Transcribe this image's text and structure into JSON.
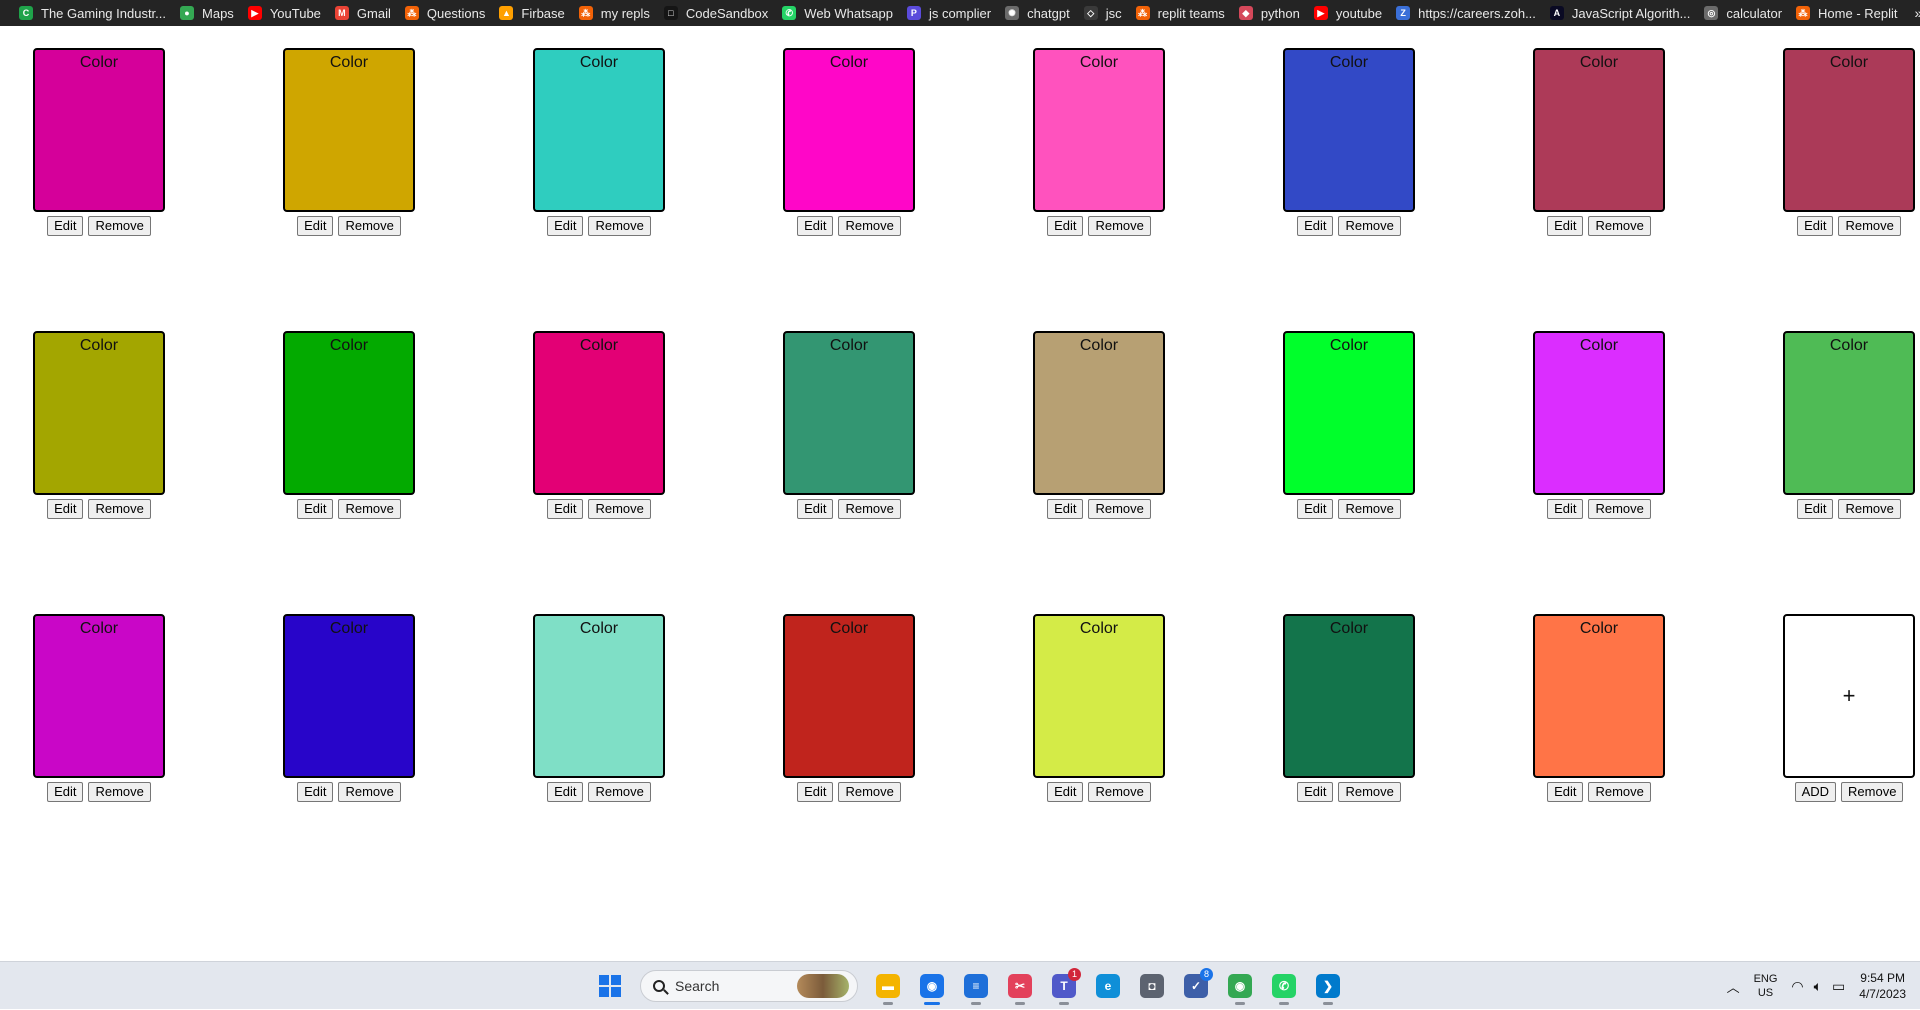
{
  "bookmarks": [
    {
      "label": "The Gaming Industr...",
      "icon": "codesandbox-green-icon",
      "color": "#1fa34a",
      "glyph": "C"
    },
    {
      "label": "Maps",
      "icon": "maps-pin-icon",
      "color": "#34a853",
      "glyph": "●"
    },
    {
      "label": "YouTube",
      "icon": "youtube-icon",
      "color": "#ff0000",
      "glyph": "▶"
    },
    {
      "label": "Gmail",
      "icon": "gmail-icon",
      "color": "#ea4335",
      "glyph": "M"
    },
    {
      "label": "Questions",
      "icon": "replit-icon",
      "color": "#f26207",
      "glyph": "⁂"
    },
    {
      "label": "Firbase",
      "icon": "firebase-icon",
      "color": "#ffa000",
      "glyph": "▲"
    },
    {
      "label": "my repls",
      "icon": "replit-icon",
      "color": "#f26207",
      "glyph": "⁂"
    },
    {
      "label": "CodeSandbox",
      "icon": "codesandbox-icon",
      "color": "#151515",
      "glyph": "□"
    },
    {
      "label": "Web Whatsapp",
      "icon": "whatsapp-icon",
      "color": "#25d366",
      "glyph": "✆"
    },
    {
      "label": "js complier",
      "icon": "js-compiler-icon",
      "color": "#5b4bdb",
      "glyph": "P"
    },
    {
      "label": "chatgpt",
      "icon": "chatgpt-icon",
      "color": "#6b6b6b",
      "glyph": "✺"
    },
    {
      "label": "jsc",
      "icon": "code-brackets-icon",
      "color": "#3a3a3a",
      "glyph": "◇"
    },
    {
      "label": "replit teams",
      "icon": "replit-icon",
      "color": "#f26207",
      "glyph": "⁂"
    },
    {
      "label": "python",
      "icon": "python-icon",
      "color": "#d5485a",
      "glyph": "◆"
    },
    {
      "label": "youtube",
      "icon": "youtube-icon",
      "color": "#ff0000",
      "glyph": "▶"
    },
    {
      "label": "https://careers.zoh...",
      "icon": "zoho-icon",
      "color": "#3a6fd8",
      "glyph": "Z"
    },
    {
      "label": "JavaScript Algorith...",
      "icon": "freecodecamp-icon",
      "color": "#0a0a23",
      "glyph": "A"
    },
    {
      "label": "calculator",
      "icon": "globe-icon",
      "color": "#6b6b6b",
      "glyph": "◎"
    },
    {
      "label": "Home - Replit",
      "icon": "replit-icon",
      "color": "#f26207",
      "glyph": "⁂"
    }
  ],
  "bookmarks_more": "»",
  "cards": [
    {
      "label": "Color",
      "color": "#d5009a"
    },
    {
      "label": "Color",
      "color": "#cfa600"
    },
    {
      "label": "Color",
      "color": "#2fcdbf"
    },
    {
      "label": "Color",
      "color": "#ff06c8"
    },
    {
      "label": "Color",
      "color": "#ff52be"
    },
    {
      "label": "Color",
      "color": "#3249c6"
    },
    {
      "label": "Color",
      "color": "#ad3a58"
    },
    {
      "label": "Color",
      "color": "#ab3a58"
    },
    {
      "label": "Color",
      "color": "#a3a600"
    },
    {
      "label": "Color",
      "color": "#03aa00"
    },
    {
      "label": "Color",
      "color": "#e30075"
    },
    {
      "label": "Color",
      "color": "#339672"
    },
    {
      "label": "Color",
      "color": "#b7a073"
    },
    {
      "label": "Color",
      "color": "#00ff2b"
    },
    {
      "label": "Color",
      "color": "#db2dff"
    },
    {
      "label": "Color",
      "color": "#4fbb55"
    },
    {
      "label": "Color",
      "color": "#c906c7"
    },
    {
      "label": "Color",
      "color": "#2805c9"
    },
    {
      "label": "Color",
      "color": "#7fdfc6"
    },
    {
      "label": "Color",
      "color": "#c0241d"
    },
    {
      "label": "Color",
      "color": "#d4eb47"
    },
    {
      "label": "Color",
      "color": "#13744b"
    },
    {
      "label": "Color",
      "color": "#ff7447"
    }
  ],
  "card_buttons": {
    "edit": "Edit",
    "remove": "Remove"
  },
  "add_card": {
    "symbol": "+",
    "add_label": "ADD",
    "remove_label": "Remove"
  },
  "taskbar": {
    "search_label": "Search",
    "apps": [
      {
        "name": "file-explorer-icon",
        "color": "#f4b400",
        "glyph": "▬"
      },
      {
        "name": "chrome-icon",
        "color": "#1a73e8",
        "glyph": "◉",
        "badge": "",
        "active": true
      },
      {
        "name": "notepad-icon",
        "color": "#1e6fd9",
        "glyph": "≡"
      },
      {
        "name": "snipping-tool-icon",
        "color": "#e3415b",
        "glyph": "✂"
      },
      {
        "name": "teams-icon",
        "color": "#5059c9",
        "glyph": "T",
        "badge": "1"
      },
      {
        "name": "edge-icon",
        "color": "#0f8fd8",
        "glyph": "e"
      },
      {
        "name": "camera-icon",
        "color": "#5c6370",
        "glyph": "◘"
      },
      {
        "name": "todo-icon",
        "color": "#3d5fa8",
        "glyph": "✓",
        "badge": "8"
      },
      {
        "name": "chrome-profile-icon",
        "color": "#34a853",
        "glyph": "◉"
      },
      {
        "name": "whatsapp-icon",
        "color": "#25d366",
        "glyph": "✆"
      },
      {
        "name": "vscode-icon",
        "color": "#007acc",
        "glyph": "❯"
      }
    ],
    "lang_top": "ENG",
    "lang_bottom": "US",
    "time": "9:54 PM",
    "date": "4/7/2023"
  }
}
